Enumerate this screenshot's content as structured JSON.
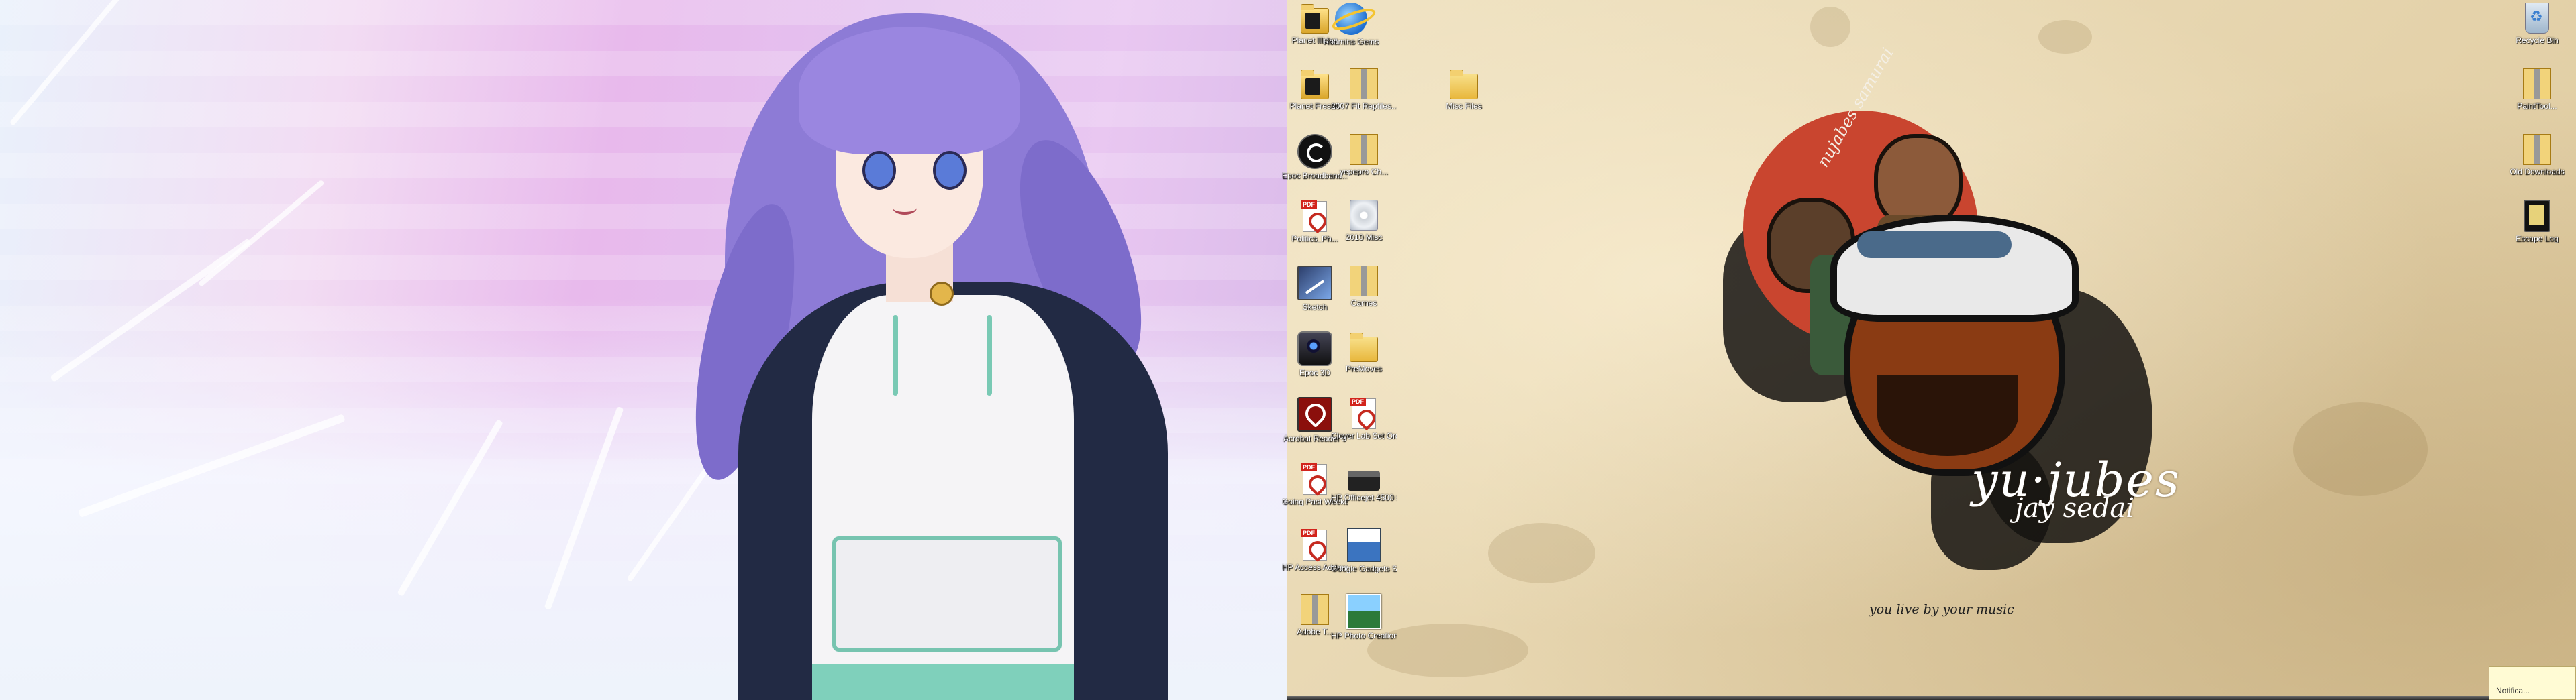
{
  "left_monitor": {
    "wallpaper": "anime character with purple hair in frosty snow scene"
  },
  "right_monitor": {
    "wallpaper_art": {
      "title": "yu·jubes",
      "subtitle": "jay sedai",
      "tagline": "you live by your music",
      "arc_text": "nujabes samurai"
    },
    "desktop_icons": [
      {
        "label": "Planet Illidan",
        "icon": "folder-dark-icon"
      },
      {
        "label": "Roamins Gems",
        "icon": "internet-explorer-icon"
      },
      {
        "label": "Planet Fresno",
        "icon": "folder-dark-icon"
      },
      {
        "label": "2007 Fit Reptiles...",
        "icon": "zip-folder-icon"
      },
      {
        "label": "Misc Files",
        "icon": "folder-icon"
      },
      {
        "label": "Epoc Broadband...",
        "icon": "app-icon"
      },
      {
        "label": "yepepro Ch...",
        "icon": "zip-folder-icon"
      },
      {
        "label": "Politics_Ph...",
        "icon": "pdf-icon"
      },
      {
        "label": "2010 Misc",
        "icon": "disc-icon"
      },
      {
        "label": "Sketch",
        "icon": "sketch-icon"
      },
      {
        "label": "Carnes",
        "icon": "zip-folder-icon"
      },
      {
        "label": "Epoc 3D",
        "icon": "camera-icon"
      },
      {
        "label": "PreMoves",
        "icon": "folder-icon"
      },
      {
        "label": "Acrobat Reader 9",
        "icon": "acrobat-icon"
      },
      {
        "label": "Clever Lab Set Ord...",
        "icon": "pdf-icon"
      },
      {
        "label": "Going Past Weekend Log",
        "icon": "pdf-icon"
      },
      {
        "label": "HP Officejet 4500 series",
        "icon": "printer-icon"
      },
      {
        "label": "HP Access Address B...",
        "icon": "pdf-icon"
      },
      {
        "label": "Google Gadgets S...",
        "icon": "gadget-icon"
      },
      {
        "label": "Adobe T...",
        "icon": "zip-folder-icon"
      },
      {
        "label": "HP Photo Creations",
        "icon": "photo-icon"
      },
      {
        "label": "Recycle Bin",
        "icon": "recycle-bin-icon"
      },
      {
        "label": "PaintTool...",
        "icon": "zip-folder-icon"
      },
      {
        "label": "Old Downloads",
        "icon": "zip-folder-icon"
      },
      {
        "label": "Escape Log",
        "icon": "movie-icon"
      }
    ],
    "notification": {
      "text": "Notifica..."
    }
  }
}
